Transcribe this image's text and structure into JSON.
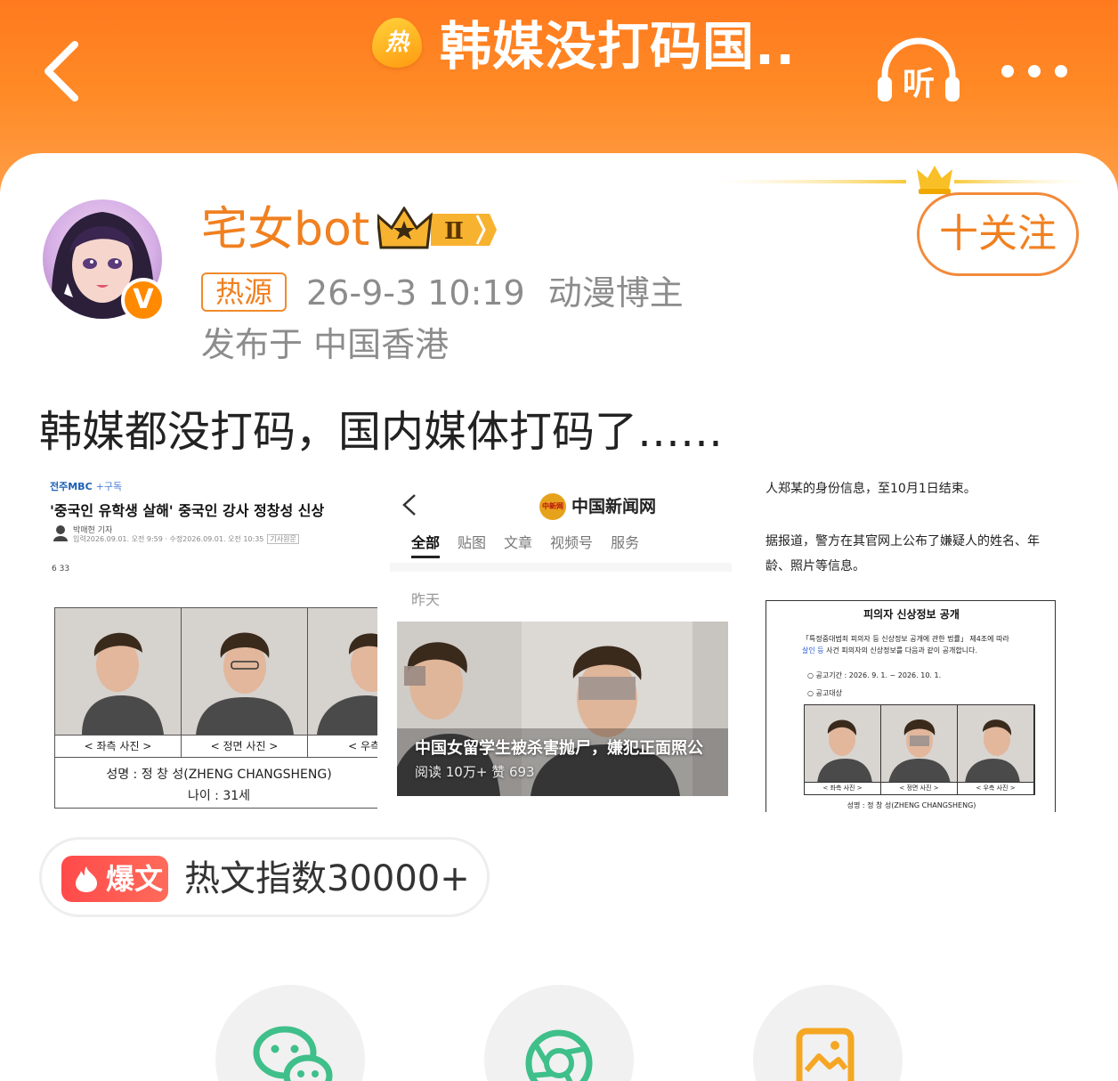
{
  "header": {
    "hot_badge": "热",
    "title": "韩媒没打码国...",
    "listen_label": "听"
  },
  "post": {
    "author": {
      "name": "宅女bot",
      "verified_badge": "V",
      "vip_level": "Ⅱ"
    },
    "follow_label": "十关注",
    "source_tag": "热源",
    "timestamp": "26-9-3 10:19",
    "role": "动漫博主",
    "location": "发布于 中国香港",
    "text": "韩媒都没打码，国内媒体打码了……"
  },
  "images": {
    "img1": {
      "source": "전주MBC",
      "subscribe": "+구독",
      "headline": "'중국인 유학생 살해' 중국인 강사 정창성 신상",
      "reporter": "박매현 기자",
      "dates": "입력2026.09.01. 오전 9:59 · 수정2026.09.01. 오전 10:35",
      "original": "기사원문",
      "reactions": "6   33",
      "labels": [
        "< 좌측 사진 >",
        "< 정면 사진 >",
        "< 우측 사"
      ],
      "name_row": "성명 : 정 창 성(ZHENG CHANGSHENG)",
      "age_row": "나이 : 31세"
    },
    "img2": {
      "logo": "中新网",
      "site": "中国新闻网",
      "tabs": [
        "全部",
        "贴图",
        "文章",
        "视频号",
        "服务"
      ],
      "yesterday": "昨天",
      "caption": "中国女留学生被杀害抛尸，嫌犯正面照公",
      "stats": "阅读 10万+  赞 693"
    },
    "img3": {
      "p1": "人郑某的身份信息，至10月1日结束。",
      "p2": "据报道，警方在其官网上公布了嫌疑人的姓名、年龄、照片等信息。",
      "doc_title": "피의자 신상정보 공개",
      "doc_law_1": "「특정중대범죄 피의자 등 신상정보 공개에 관한 법률」 제4조에 따라",
      "doc_law_highlight": "살인 등",
      "doc_law_2": " 사건 피의자의 신상정보를 다음과 같이 공개합니다.",
      "doc_period": "○ 공고기간 : 2026. 9. 1. ~ 2026. 10. 1.",
      "doc_target": "○ 공고대상",
      "doc_labels": [
        "< 좌측 사진 >",
        "< 정면 사진 >",
        "< 우측 사진 >"
      ],
      "doc_name": "성명 : 정 창 성(ZHENG CHANGSHENG)"
    }
  },
  "hot_index": {
    "badge": "爆文",
    "text": "热文指数30000+"
  },
  "colors": {
    "brand_orange": "#ff7a1e",
    "accent_text": "#f08020",
    "hot_red": "#ff4a4a",
    "share_green": "#3fbf8a"
  },
  "icons": [
    "back-arrow-icon",
    "listen-icon",
    "more-icon",
    "crown-icon",
    "flame-icon",
    "wechat-icon",
    "moments-icon",
    "image-share-icon"
  ]
}
